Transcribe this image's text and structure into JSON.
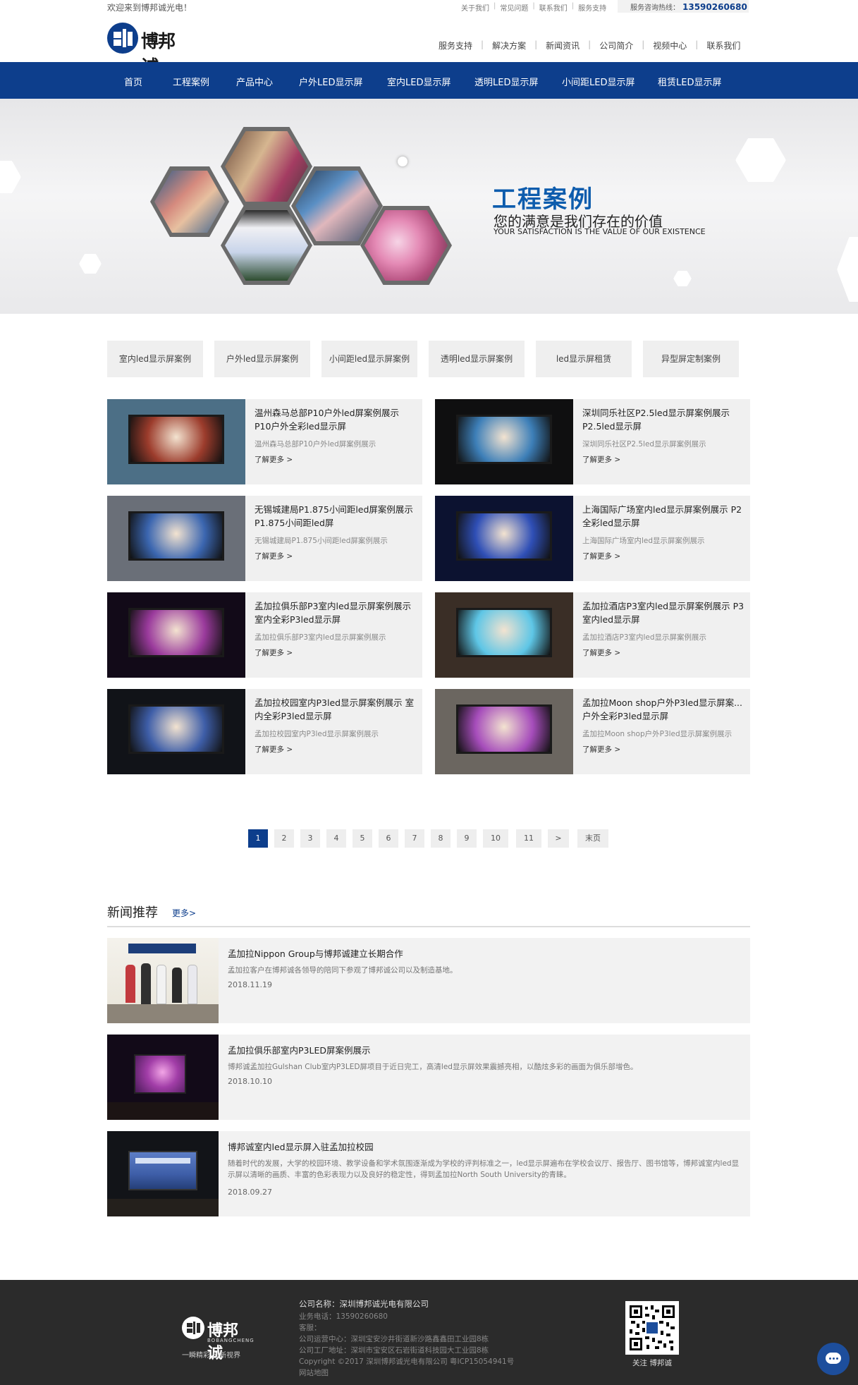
{
  "topbar": {
    "welcome": "欢迎来到博邦诚光电！",
    "links": [
      "关于我们",
      "常见问题",
      "联系我们",
      "服务支持"
    ],
    "hotline_label": "服务咨询热线：",
    "hotline_number": "13590260680"
  },
  "header": {
    "logo_text": "博邦诚",
    "links": [
      "服务支持",
      "解决方案",
      "新闻资讯",
      "公司简介",
      "视频中心",
      "联系我们"
    ]
  },
  "nav": [
    "首页",
    "工程案例",
    "产品中心",
    "户外LED显示屏",
    "室内LED显示屏",
    "透明LED显示屏",
    "小间距LED显示屏",
    "租赁LED显示屏"
  ],
  "banner": {
    "title": "工程案例",
    "subtitle": "您的满意是我们存在的价值",
    "english": "YOUR SATISFACTION IS THE VALUE OF OUR EXISTENCE"
  },
  "categories": [
    "室内led显示屏案例",
    "户外led显示屏案例",
    "小间距led显示屏案例",
    "透明led显示屏案例",
    "led显示屏租赁",
    "异型屏定制案例"
  ],
  "cases": [
    {
      "title": "温州森马总部P10户外led屏案例展示 P10户外全彩led显示屏",
      "desc": "温州森马总部P10户外led屏案例展示",
      "more": "了解更多 >",
      "bg": "#4c6f86",
      "screen": "#9c3c2c"
    },
    {
      "title": "深圳同乐社区P2.5led显示屏案例展示 P2.5led显示屏",
      "desc": "深圳同乐社区P2.5led显示屏案例展示",
      "more": "了解更多 >",
      "bg": "#0f0f10",
      "screen": "#3d7fb8"
    },
    {
      "title": "无锡城建局P1.875小间距led屏案例展示 P1.875小间距led屏",
      "desc": "无锡城建局P1.875小间距led屏案例展示",
      "more": "了解更多 >",
      "bg": "#6a6f78",
      "screen": "#3b66b0"
    },
    {
      "title": "上海国际广场室内led显示屏案例展示 P2全彩led显示屏",
      "desc": "上海国际广场室内led显示屏案例展示",
      "more": "了解更多 >",
      "bg": "#0c1230",
      "screen": "#2f4fb6"
    },
    {
      "title": "孟加拉俱乐部P3室内led显示屏案例展示 室内全彩P3led显示屏",
      "desc": "孟加拉俱乐部P3室内led显示屏案例展示",
      "more": "了解更多 >",
      "bg": "#120a18",
      "screen": "#9a3a9c"
    },
    {
      "title": "孟加拉酒店P3室内led显示屏案例展示 P3室内led显示屏",
      "desc": "孟加拉酒店P3室内led显示屏案例展示",
      "more": "了解更多 >",
      "bg": "#3a2e26",
      "screen": "#5ec6e6"
    },
    {
      "title": "孟加拉校园室内P3led显示屏案例展示 室内全彩P3led显示屏",
      "desc": "孟加拉校园室内P3led显示屏案例展示",
      "more": "了解更多 >",
      "bg": "#111318",
      "screen": "#3e5ea8"
    },
    {
      "title": "孟加拉Moon shop户外P3led显示屏案... 户外全彩P3led显示屏",
      "desc": "孟加拉Moon shop户外P3led显示屏案例展示",
      "more": "了解更多 >",
      "bg": "#6b6660",
      "screen": "#a64dbb"
    }
  ],
  "pager": [
    "1",
    "2",
    "3",
    "4",
    "5",
    "6",
    "7",
    "8",
    "9",
    "10",
    "11",
    ">",
    "末页"
  ],
  "news_section": {
    "heading": "新闻推荐",
    "more": "更多>"
  },
  "news": [
    {
      "title": "孟加拉Nippon Group与博邦诚建立长期合作",
      "desc": "孟加拉客户在博邦诚各领导的陪同下参观了博邦诚公司以及制造基地。",
      "date": "2018.11.19"
    },
    {
      "title": "孟加拉俱乐部室内P3LED屏案例展示",
      "desc": "博邦诚孟加拉Gulshan Club室内P3LED屏项目于近日完工，高清led显示屏效果震撼亮相，以酷炫多彩的画面为俱乐部增色。",
      "date": "2018.10.10"
    },
    {
      "title": "博邦诚室内led显示屏入驻孟加拉校园",
      "desc": "随着时代的发展，大学的校园环境、教学设备和学术氛围逐渐成为学校的评判标准之一，led显示屏遍布在学校会议厅、报告厅、图书馆等，博邦诚室内led显示屏以清晰的画质、丰富的色彩表现力以及良好的稳定性，得到孟加拉North South University的青睐。",
      "date": "2018.09.27"
    }
  ],
  "footer": {
    "logo_text": "博邦诚",
    "logo_en": "BOBANGCHENG",
    "slogan": "一瞬精彩 创新视界",
    "company": "公司名称：深圳博邦诚光电有限公司",
    "lines": [
      "业务电话：13590260680",
      "客服：",
      "公司运营中心：深圳宝安沙井街道新沙路鑫鑫田工业园8栋",
      "公司工厂地址：深圳市宝安区石岩街道科技园大工业园8栋",
      "Copyright ©2017 深圳博邦诚光电有限公司 粤ICP15054941号",
      "网站地图"
    ],
    "qr_caption": "关注 博邦诚"
  }
}
